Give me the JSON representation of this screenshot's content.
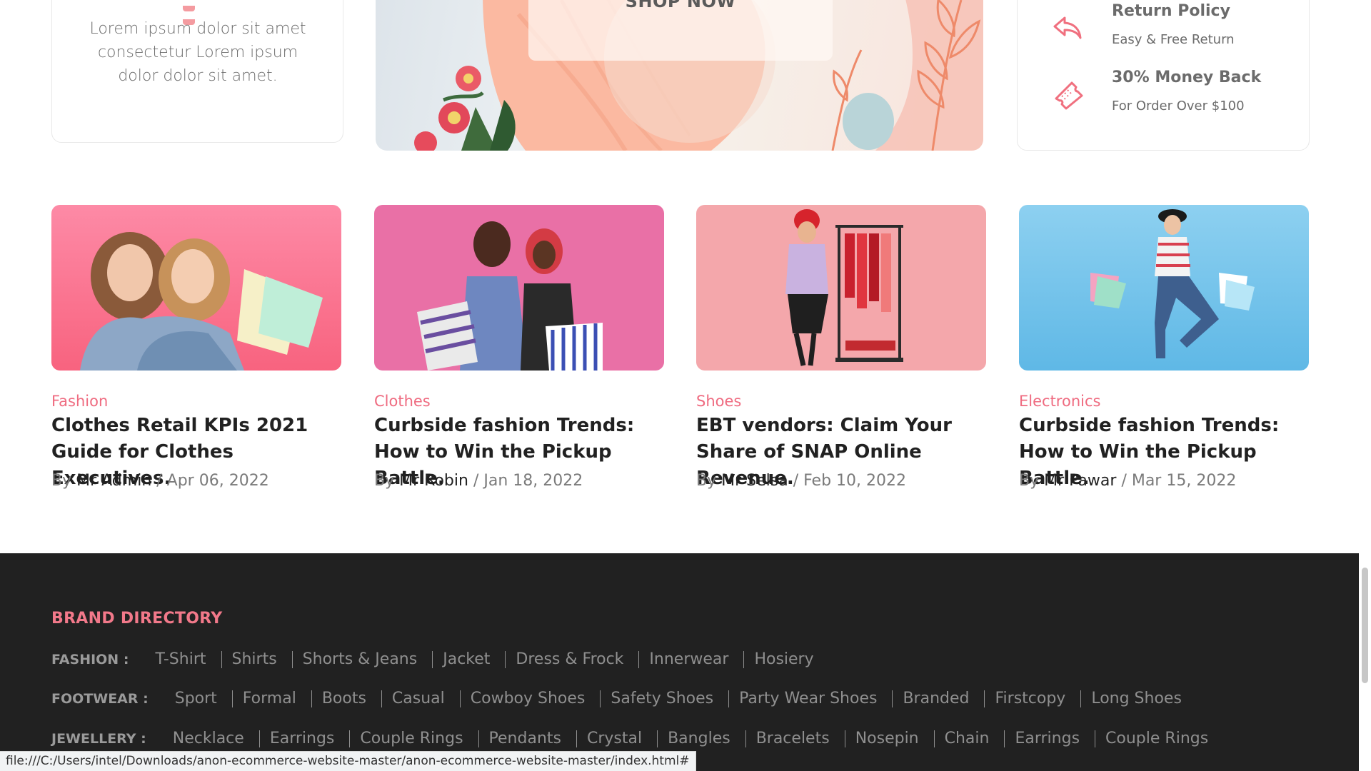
{
  "testimonial": {
    "text": "Lorem ipsum dolor sit amet consectetur Lorem ipsum dolor dolor sit amet."
  },
  "banner": {
    "button_label": "SHOP NOW"
  },
  "services": [
    {
      "icon": "return-arrow-icon",
      "title": "Return Policy",
      "subtitle": "Easy & Free Return"
    },
    {
      "icon": "ticket-icon",
      "title": "30% Money Back",
      "subtitle": "For Order Over $100"
    }
  ],
  "blog": [
    {
      "category": "Fashion",
      "title": "Clothes Retail KPIs 2021 Guide for Clothes Executives.",
      "by": "By",
      "author": "Mr Admin",
      "date": "/ Apr 06, 2022"
    },
    {
      "category": "Clothes",
      "title": "Curbside fashion Trends: How to Win the Pickup Battle.",
      "by": "By",
      "author": "Mr Robin",
      "date": "/ Jan 18, 2022"
    },
    {
      "category": "Shoes",
      "title": "EBT vendors: Claim Your Share of SNAP Online Revenue.",
      "by": "By",
      "author": "Mr Selsa",
      "date": "/ Feb 10, 2022"
    },
    {
      "category": "Electronics",
      "title": "Curbside fashion Trends: How to Win the Pickup Battle.",
      "by": "By",
      "author": "Mr Pawar",
      "date": "/ Mar 15, 2022"
    }
  ],
  "footer": {
    "brand_title": "BRAND DIRECTORY",
    "rows": [
      {
        "label": "FASHION :",
        "links": [
          "T-Shirt",
          "Shirts",
          "Shorts & Jeans",
          "Jacket",
          "Dress & Frock",
          "Innerwear",
          "Hosiery"
        ]
      },
      {
        "label": "FOOTWEAR :",
        "links": [
          "Sport",
          "Formal",
          "Boots",
          "Casual",
          "Cowboy Shoes",
          "Safety Shoes",
          "Party Wear Shoes",
          "Branded",
          "Firstcopy",
          "Long Shoes"
        ]
      },
      {
        "label": "JEWELLERY :",
        "links": [
          "Necklace",
          "Earrings",
          "Couple Rings",
          "Pendants",
          "Crystal",
          "Bangles",
          "Bracelets",
          "Nosepin",
          "Chain",
          "Earrings",
          "Couple Rings"
        ]
      }
    ]
  },
  "status_bar": {
    "url": "file:///C:/Users/intel/Downloads/anon-ecommerce-website-master/anon-ecommerce-website-master/index.html#"
  },
  "colors": {
    "accent": "#ef6b80",
    "footer_bg": "#212121",
    "brand_title": "#f2798a"
  }
}
